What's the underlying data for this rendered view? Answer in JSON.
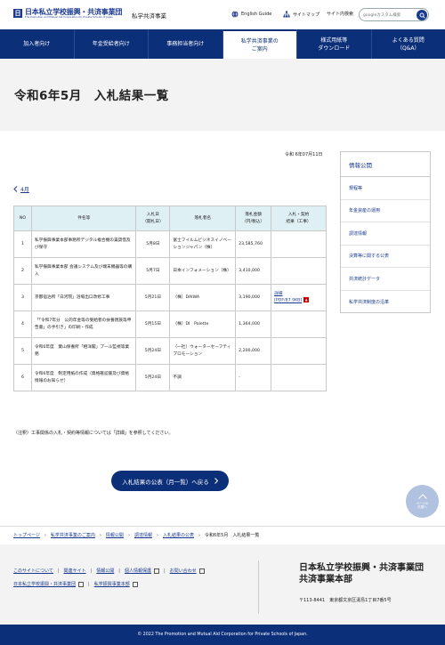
{
  "header": {
    "logo_mark": "日",
    "logo_ja": "日本私立学校振興・共済事業団",
    "logo_en": "The Promotion and Mutual Aid Corporation for Private Schools of Japan",
    "site_title": "私学共済事業",
    "english_guide": "English Guide",
    "sitemap": "サイトマップ",
    "site_search_label": "サイト内検索",
    "search_placeholder": "googleカスタム検索"
  },
  "nav": {
    "items": [
      {
        "label": "加入者向け"
      },
      {
        "label": "年金受給者向け"
      },
      {
        "label": "事務担当者向け"
      },
      {
        "label": "私学共済事業の\nご案内",
        "active": true
      },
      {
        "label": "様式用紙等\nダウンロード"
      },
      {
        "label": "よくある質問\n（Q&A）"
      }
    ]
  },
  "page": {
    "title": "令和6年5月　入札結果一覧",
    "date": "令和 6年07月11日",
    "back_month": "4月"
  },
  "table": {
    "headers": {
      "no": "NO",
      "name": "件名等",
      "date": "入札日\n（開札日）",
      "winner": "落札者名",
      "amount": "落札金額\n（円/税込）",
      "link": "入札・契約\n結果（工事）"
    },
    "rows": [
      {
        "no": "1",
        "name": "私学振興事業本部事務所デジタル複合機の賃貸借及び保守",
        "date": "5月8日",
        "winner": "富士フイルムビジネスイノベーションジャパン（株）",
        "amount": "23,585,760",
        "link": ""
      },
      {
        "no": "2",
        "name": "私学振興事業本部 会議システム及び端末機器等の購入",
        "date": "5月7日",
        "winner": "日本インフォメーション（株）",
        "amount": "3,410,000",
        "link": ""
      },
      {
        "no": "3",
        "name": "京都宿泊所「白河院」浴場出口改修工事",
        "date": "5月21日",
        "winner": "（株）DAIWA",
        "amount": "3,190,000",
        "link": "詳細\n[PDF/87.9KB]"
      },
      {
        "no": "4",
        "name": "「「令和7年分　公的年金等の受給者の扶養親族等申告書」の手引き」の印刷・作成",
        "date": "5月15日",
        "winner": "（株）DI　Palette",
        "amount": "1,364,000",
        "link": ""
      },
      {
        "no": "5",
        "name": "令和6年度　葉山保養所「相洋閣」プール監視等業務",
        "date": "5月24日",
        "winner": "（一社）ウォーターセーフティプロモーション",
        "amount": "2,200,000",
        "link": ""
      },
      {
        "no": "6",
        "name": "令和6年度　制定用紙の作成（資格確認書及び資格情報のお知らせ）",
        "date": "5月24日",
        "winner": "不調",
        "amount": "-",
        "link": ""
      }
    ]
  },
  "sidebar": {
    "heading": "情報公開",
    "items": [
      {
        "label": "規程等"
      },
      {
        "label": "年金資産の運用"
      },
      {
        "label": "調達情報"
      },
      {
        "label": "決算等に関する公表"
      },
      {
        "label": "共済統計データ"
      },
      {
        "label": "私学共済制度の沿革"
      }
    ]
  },
  "note": "（注釈）工事関係の入札・契約等情報については「詳細」を参照してください。",
  "cta_label": "入札結果の公表（月一覧）へ戻る",
  "page_top_label": "ページの\n先頭へ",
  "breadcrumb": {
    "items": [
      "トップページ",
      "私学共済事業のご案内",
      "情報公開",
      "調達情報",
      "入札結果の公表"
    ],
    "current": "令和6年5月　入札結果一覧"
  },
  "footer": {
    "links_row1": [
      "このサイトについて",
      "関連サイト",
      "情報公開",
      "個人情報保護",
      "お問い合わせ"
    ],
    "links_row2": [
      "日本私立学校振興・共済事業団",
      "私学振興事業本部"
    ],
    "org_line1": "日本私立学校振興・共済事業団",
    "org_line2": "共済事業本部",
    "address": "〒113-8441　東京都文京区湯島1丁目7番5号",
    "copyright": "© 2022 The Promotion and Mutual Aid Corporation for Private Schools of Japan."
  },
  "colors": {
    "brand_navy": "#0c2f7a",
    "table_header": "#dff0f5",
    "band_gray": "#f3f3f3",
    "pdf_red": "#cc0000"
  }
}
